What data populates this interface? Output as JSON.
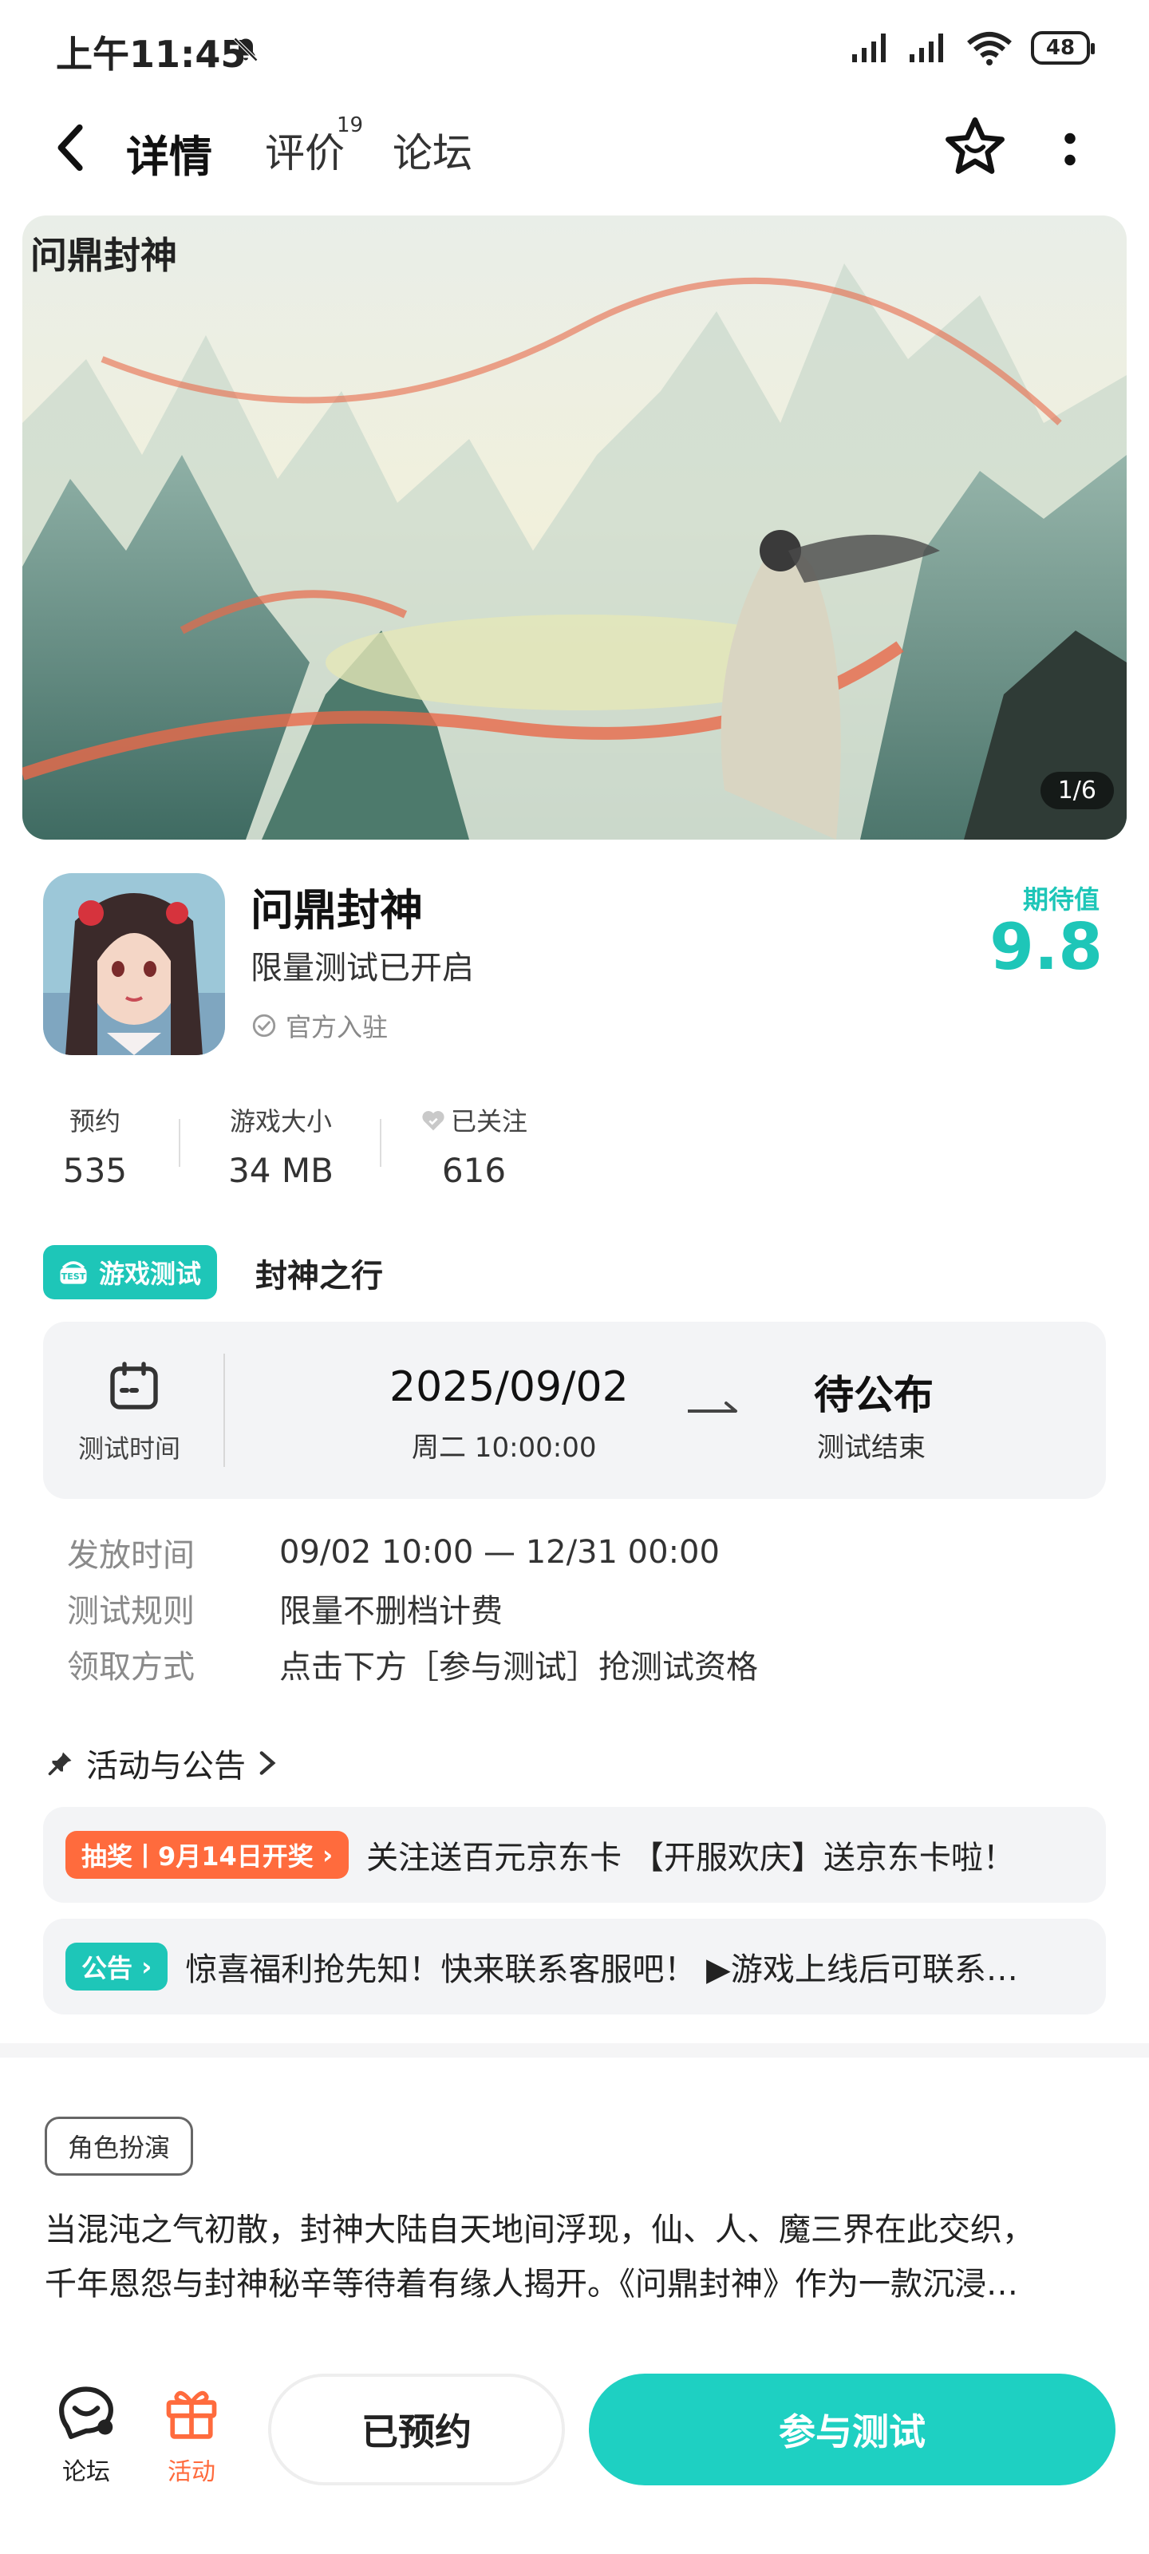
{
  "status_bar": {
    "time": "上午11:45",
    "battery": "48"
  },
  "nav": {
    "tabs": [
      {
        "label": "详情"
      },
      {
        "label": "评价",
        "badge": "19"
      },
      {
        "label": "论坛"
      }
    ]
  },
  "banner": {
    "title": "问鼎封神",
    "counter": "1/6"
  },
  "app": {
    "name": "问鼎封神",
    "subtitle": "限量测试已开启",
    "official": "官方入驻",
    "expect_label": "期待值",
    "expect_score": "9.8"
  },
  "stats": [
    {
      "label": "预约",
      "value": "535"
    },
    {
      "label": "游戏大小",
      "value": "34 MB"
    },
    {
      "label": "已关注",
      "value": "616"
    }
  ],
  "test": {
    "badge": "游戏测试",
    "name": "封神之行",
    "time_label": "测试时间",
    "start_date": "2025/09/02",
    "start_time": "周二  10:00:00",
    "end_main": "待公布",
    "end_sub": "测试结束"
  },
  "info_rows": [
    {
      "key": "发放时间",
      "value": "09/02 10:00 — 12/31 00:00"
    },
    {
      "key": "测试规则",
      "value": "限量不删档计费"
    },
    {
      "key": "领取方式",
      "value": "点击下方［参与测试］抢测试资格"
    }
  ],
  "activity": {
    "header": "活动与公告",
    "items": [
      {
        "tag": "抽奖丨9月14日开奖",
        "text": "关注送百元京东卡 【开服欢庆】送京东卡啦！"
      },
      {
        "tag": "公告",
        "text": "惊喜福利抢先知！快来联系客服吧！ ▶游戏上线后可联系…"
      }
    ]
  },
  "genre": "角色扮演",
  "description": [
    "当混沌之气初散，封神大陆自天地间浮现，仙、人、魔三界在此交织，",
    "千年恩怨与封神秘辛等待着有缘人揭开。《问鼎封神》作为一款沉浸…"
  ],
  "bottom": {
    "forum": "论坛",
    "activity": "活动",
    "reserved": "已预约",
    "join": "参与测试"
  },
  "colors": {
    "accent": "#1ec6b8",
    "orange": "#ff6b3d"
  }
}
